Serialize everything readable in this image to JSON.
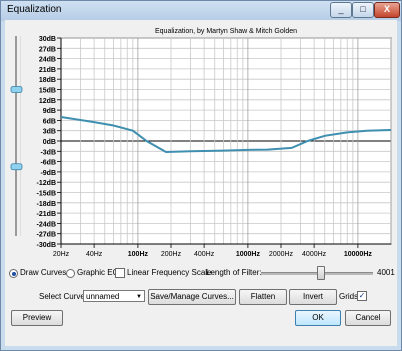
{
  "window": {
    "title": "Equalization",
    "buttons": {
      "minimize": "_",
      "maximize": "□",
      "close": "X"
    }
  },
  "plot": {
    "title": "Equalization, by Martyn Shaw & Mitch Golden",
    "y_ticks": [
      "30dB",
      "27dB",
      "24dB",
      "21dB",
      "18dB",
      "15dB",
      "12dB",
      "9dB",
      "6dB",
      "3dB",
      "0dB",
      "-3dB",
      "-6dB",
      "-9dB",
      "-12dB",
      "-15dB",
      "-18dB",
      "-21dB",
      "-24dB",
      "-27dB",
      "-30dB"
    ],
    "x_ticks": [
      {
        "label": "20Hz",
        "freq": 20,
        "bold": false
      },
      {
        "label": "40Hz",
        "freq": 40,
        "bold": false
      },
      {
        "label": "100Hz",
        "freq": 100,
        "bold": true
      },
      {
        "label": "200Hz",
        "freq": 200,
        "bold": false
      },
      {
        "label": "400Hz",
        "freq": 400,
        "bold": false
      },
      {
        "label": "1000Hz",
        "freq": 1000,
        "bold": true
      },
      {
        "label": "2000Hz",
        "freq": 2000,
        "bold": false
      },
      {
        "label": "4000Hz",
        "freq": 4000,
        "bold": false
      },
      {
        "label": "10000Hz",
        "freq": 10000,
        "bold": true
      }
    ],
    "curve": [
      [
        20,
        7
      ],
      [
        40,
        5.5
      ],
      [
        60,
        4.5
      ],
      [
        90,
        3
      ],
      [
        120,
        0
      ],
      [
        180,
        -3.2
      ],
      [
        300,
        -3.0
      ],
      [
        600,
        -2.8
      ],
      [
        1000,
        -2.6
      ],
      [
        1500,
        -2.5
      ],
      [
        2500,
        -2.0
      ],
      [
        3500,
        0
      ],
      [
        5000,
        1.5
      ],
      [
        8000,
        2.5
      ],
      [
        12000,
        3.0
      ],
      [
        20000,
        3.2
      ]
    ],
    "curve_color": "#3f8fb0",
    "slider_levels_db": [
      {
        "name": "upper",
        "value": 15
      },
      {
        "name": "lower",
        "value": -7.5
      }
    ]
  },
  "controls": {
    "draw_curves": "Draw Curves",
    "graphic_eq": "Graphic EQ",
    "linear_scale": "Linear Frequency Scale",
    "length_label": "Length of Filter:",
    "length_value": "4001",
    "length_fraction": 0.53,
    "select_curve_label": "Select Curve:",
    "curve_selected": "unnamed",
    "save_manage": "Save/Manage Curves...",
    "flatten": "Flatten",
    "invert": "Invert",
    "grids": "Grids",
    "preview": "Preview",
    "ok": "OK",
    "cancel": "Cancel"
  }
}
